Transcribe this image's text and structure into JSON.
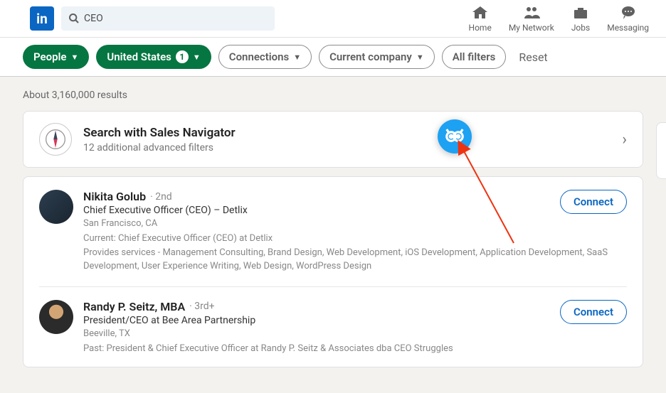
{
  "header": {
    "logo": "in",
    "search_query": "CEO",
    "nav": {
      "home": "Home",
      "network": "My Network",
      "jobs": "Jobs",
      "messaging": "Messaging"
    }
  },
  "filters": {
    "people": "People",
    "location": "United States",
    "location_count": "1",
    "connections": "Connections",
    "company": "Current company",
    "all": "All filters",
    "reset": "Reset"
  },
  "results": {
    "count_text": "About 3,160,000 results",
    "sales_nav": {
      "title": "Search with Sales Navigator",
      "sub": "12 additional advanced filters"
    },
    "people": [
      {
        "name": "Nikita Golub",
        "degree": "· 2nd",
        "headline": "Chief Executive Officer (CEO) – Detlix",
        "location": "San Francisco, CA",
        "current": "Current: Chief Executive Officer (CEO) at Detlix",
        "services": "Provides services - Management Consulting, Brand Design, Web Development, iOS Development, Application Development, SaaS Development, User Experience Writing, Web Design, WordPress Design",
        "connect": "Connect"
      },
      {
        "name": "Randy P. Seitz, MBA",
        "degree": "· 3rd+",
        "headline": "President/CEO at Bee Area Partnership",
        "location": "Beeville, TX",
        "current": "Past: President & Chief Executive Officer at Randy P. Seitz & Associates dba CEO Struggles",
        "services": "",
        "connect": "Connect"
      }
    ]
  }
}
